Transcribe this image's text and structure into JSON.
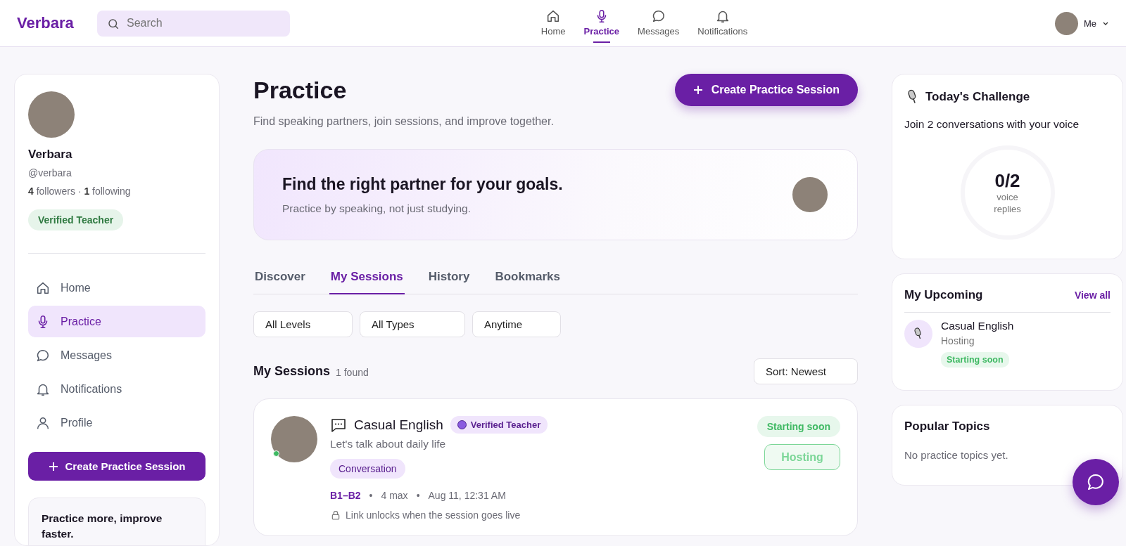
{
  "brand": "Verbara",
  "search": {
    "placeholder": "Search"
  },
  "nav": [
    {
      "label": "Home",
      "selected": false
    },
    {
      "label": "Practice",
      "selected": true
    },
    {
      "label": "Messages",
      "selected": false
    },
    {
      "label": "Notifications",
      "selected": false
    }
  ],
  "account": {
    "label": "Me"
  },
  "profile": {
    "name": "Verbara",
    "handle": "@verbara",
    "stats": "**4** followers · **1** following",
    "badge": "Verified Teacher"
  },
  "sidebar": {
    "items": [
      {
        "label": "Home",
        "selected": false
      },
      {
        "label": "Practice",
        "selected": true
      },
      {
        "label": "Messages",
        "selected": false
      },
      {
        "label": "Notifications",
        "selected": false
      },
      {
        "label": "Profile",
        "selected": false
      }
    ],
    "create_button": "Create Practice Session",
    "promo": {
      "title": "Practice more, improve faster."
    }
  },
  "header": {
    "title": "Practice",
    "subtitle": "Find speaking partners, join sessions, and improve together.",
    "create_button": "Create Practice Session"
  },
  "banner": {
    "title": "Find the right partner for your goals.",
    "text": "Practice by speaking, not just studying."
  },
  "tabs": [
    {
      "label": "Discover",
      "selected": false
    },
    {
      "label": "My Sessions",
      "selected": true
    },
    {
      "label": "History",
      "selected": false
    },
    {
      "label": "Bookmarks",
      "selected": false
    }
  ],
  "filters": [
    {
      "label": "All Levels"
    },
    {
      "label": "All Types"
    },
    {
      "label": "Anytime"
    }
  ],
  "results": {
    "title": "My Sessions",
    "count": "1 found",
    "sort": "Sort: Newest"
  },
  "sessions": [
    {
      "title": "Casual English",
      "badge": "Verified Teacher",
      "description": "Let's talk about daily life",
      "tag": "Conversation",
      "cefr": "B1–B2",
      "separator": "•",
      "capacity": "4 max",
      "time": "Aug 11, 12:31 AM",
      "note": "Link unlocks when the session goes live",
      "status": "Starting soon",
      "role": "Hosting",
      "online": true
    }
  ],
  "challenge": {
    "title": "Today's Challenge",
    "text": "Join 2 conversations with your voice",
    "count": "0/2",
    "unit": "voice replies"
  },
  "upcoming": {
    "title": "My Upcoming",
    "link": "View all",
    "items": [
      {
        "title": "Casual English",
        "role": "Hosting",
        "status": "Starting soon"
      }
    ]
  },
  "topics": {
    "title": "Popular Topics",
    "empty": "No practice topics yet."
  }
}
